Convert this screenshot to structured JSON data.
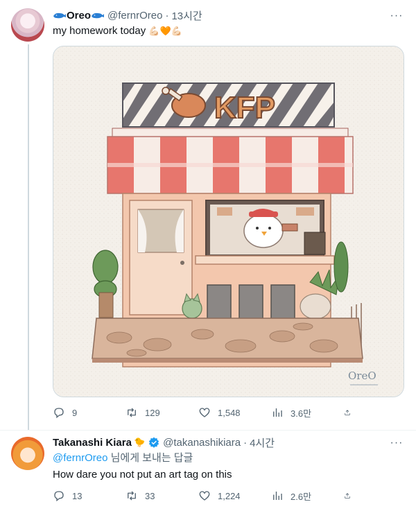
{
  "tweet1": {
    "name": "Oreo",
    "handle": "@fernrOreo",
    "time": "13시간",
    "text": "my homework today",
    "reply_count": "9",
    "retweet_count": "129",
    "like_count": "1,548",
    "view_count": "3.6만",
    "illustration": {
      "sign_text": "KFP",
      "signature": "OreO"
    }
  },
  "tweet2": {
    "name": "Takanashi Kiara",
    "handle": "@takanashikiara",
    "time": "4시간",
    "reply_mention": "@fernrOreo",
    "reply_suffix": " 님에게 보내는 답글",
    "text": "How dare you not put an art tag on this",
    "reply_count": "13",
    "retweet_count": "33",
    "like_count": "1,224",
    "view_count": "2.6만"
  },
  "colors": {
    "link": "#1d9bf0",
    "secondary_text": "#536471",
    "primary_text": "#0f1419",
    "awning_red": "#e36b63",
    "heart_orange": "#ff8a00"
  },
  "icons": [
    "reply-icon",
    "retweet-icon",
    "like-icon",
    "views-icon",
    "share-icon",
    "more-icon",
    "verified-icon",
    "whale-icon"
  ]
}
